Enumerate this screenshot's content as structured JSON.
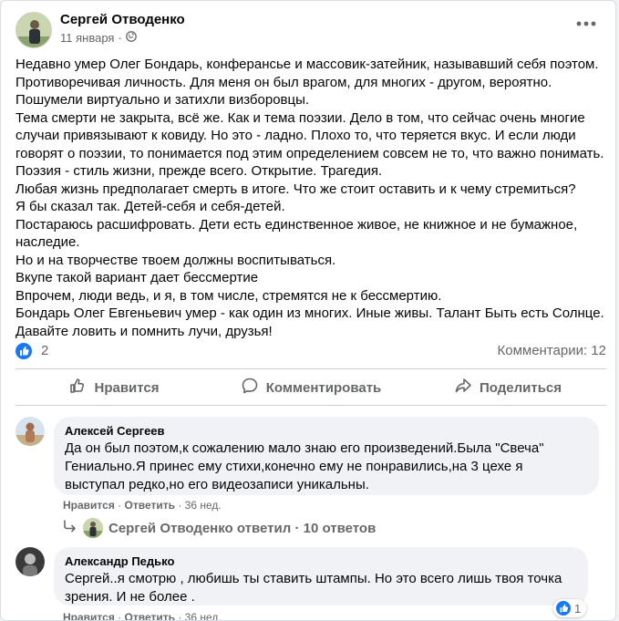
{
  "post": {
    "author": "Сергей Отводенко",
    "date": "11 января",
    "date_separator": "·",
    "body_lines": [
      "Недавно умер Олег Бондарь, конферансье и массовик-затейник, называвший себя поэтом.",
      "Противоречивая личность. Для меня он был врагом, для многих - другом, вероятно.",
      "Пошумели виртуально и затихли визборовцы.",
      "Тема смерти не закрыта, всё же. Как и тема поэзии. Дело в том, что сейчас очень многие",
      "случаи привязывают к ковиду. Но это - ладно. Плохо то, что теряется вкус. И если люди",
      "говорят о поэзии, то понимается под этим определением совсем не то, что важно понимать.",
      "Поэзия - стиль жизни, прежде всего. Открытие. Трагедия.",
      "Любая жизнь предполагает смерть в итоге. Что же стоит оставить и к чему стремиться?",
      "Я бы сказал так. Детей-себя и себя-детей.",
      "Постараюсь расшифровать. Дети есть единственное живое, не книжное и не бумажное,",
      "наследие.",
      "Но и на творчестве твоем должны воспитываться.",
      "Вкупе такой вариант дает бессмертие",
      "Впрочем, люди ведь, и я, в том числе, стремятся не к бессмертию.",
      "Бондарь Олег Евгеньевич умер - как один из многих. Иные живы. Талант Быть есть Солнце.",
      "Давайте ловить и помнить лучи, друзья!"
    ],
    "likes_count": "2",
    "comments_count": "Комментарии: 12"
  },
  "actions": {
    "like": "Нравится",
    "comment": "Комментировать",
    "share": "Поделиться"
  },
  "comments": [
    {
      "author": "Алексей Сергеев",
      "lines": [
        "Да он был поэтом,к сожалению мало знаю его произведений.Была \"Свеча\"",
        "Гениально.Я принес ему стихи,конечно ему не понравились,на 3 цехе я",
        "выступал редко,но его видеозаписи уникальны."
      ],
      "like": "Нравится",
      "reply": "Ответить",
      "time": "36 нед.",
      "dot": "·"
    },
    {
      "author": "Александр Педько",
      "lines": [
        "Сергей..я смотрю , любишь ты ставить штампы. Но это всего лишь твоя точка",
        "зрения. И не более ."
      ],
      "like": "Нравится",
      "reply": "Ответить",
      "time": "36 нед.",
      "dot": "·",
      "reaction_count": "1"
    }
  ],
  "replies_summary": {
    "text": "Сергей Отводенко ответил · 10 ответов"
  },
  "colors": {
    "accent": "#1877f2",
    "secondary_text": "#65676b",
    "bubble": "#f0f2f5"
  },
  "icons": [
    "globe-icon",
    "more-icon",
    "like-icon",
    "thumbs-up-icon",
    "comment-icon",
    "share-icon",
    "reply-arrow-icon"
  ]
}
